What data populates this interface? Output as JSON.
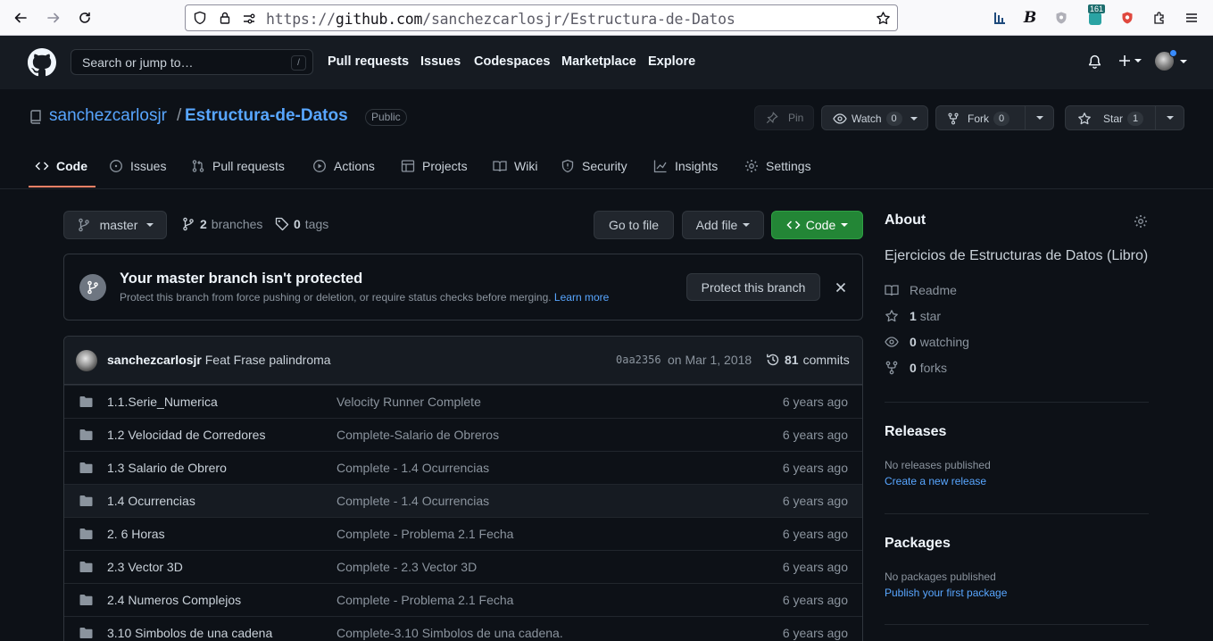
{
  "browser": {
    "url_scheme": "https://",
    "url_domain": "github.com",
    "url_path": "/sanchezcarlosjr/Estructura-de-Datos",
    "ext_badge": "161"
  },
  "header": {
    "search_placeholder": "Search or jump to…",
    "slash_key": "/",
    "nav": [
      "Pull requests",
      "Issues",
      "Codespaces",
      "Marketplace",
      "Explore"
    ]
  },
  "repo": {
    "owner": "sanchezcarlosjr",
    "separator": "/",
    "name": "Estructura-de-Datos",
    "visibility": "Public",
    "pin_label": "Pin",
    "watch_label": "Watch",
    "watch_count": "0",
    "fork_label": "Fork",
    "fork_count": "0",
    "star_label": "Star",
    "star_count": "1"
  },
  "tabs": [
    "Code",
    "Issues",
    "Pull requests",
    "Actions",
    "Projects",
    "Wiki",
    "Security",
    "Insights",
    "Settings"
  ],
  "toolbar": {
    "branch": "master",
    "branches_count": "2",
    "branches_label": "branches",
    "tags_count": "0",
    "tags_label": "tags",
    "go_to_file": "Go to file",
    "add_file": "Add file",
    "code": "Code"
  },
  "banner": {
    "title": "Your master branch isn't protected",
    "desc": "Protect this branch from force pushing or deletion, or require status checks before merging.",
    "link": "Learn more",
    "button": "Protect this branch"
  },
  "commit": {
    "author": "sanchezcarlosjr",
    "message": "Feat Frase palindroma",
    "sha": "0aa2356",
    "date": "on Mar 1, 2018",
    "count": "81",
    "count_label": "commits"
  },
  "files": [
    {
      "name": "1.1.Serie_Numerica",
      "message": "Velocity Runner Complete",
      "age": "6 years ago"
    },
    {
      "name": "1.2 Velocidad de Corredores",
      "message": "Complete-Salario de Obreros",
      "age": "6 years ago"
    },
    {
      "name": "1.3 Salario de Obrero",
      "message": "Complete - 1.4 Ocurrencias",
      "age": "6 years ago"
    },
    {
      "name": "1.4 Ocurrencias",
      "message": "Complete - 1.4 Ocurrencias",
      "age": "6 years ago"
    },
    {
      "name": "2. 6 Horas",
      "message": "Complete - Problema 2.1 Fecha",
      "age": "6 years ago"
    },
    {
      "name": "2.3 Vector 3D",
      "message": "Complete - 2.3 Vector 3D",
      "age": "6 years ago"
    },
    {
      "name": "2.4 Numeros Complejos",
      "message": "Complete - Problema 2.1 Fecha",
      "age": "6 years ago"
    },
    {
      "name": "3.10 Simbolos de una cadena",
      "message": "Complete-3.10 Simbolos de una cadena.",
      "age": "6 years ago"
    }
  ],
  "about": {
    "title": "About",
    "description": "Ejercicios de Estructuras de Datos (Libro)",
    "readme": "Readme",
    "stars_count": "1",
    "stars_label": "star",
    "watching_count": "0",
    "watching_label": "watching",
    "forks_count": "0",
    "forks_label": "forks"
  },
  "releases": {
    "title": "Releases",
    "none": "No releases published",
    "link": "Create a new release"
  },
  "packages": {
    "title": "Packages",
    "none": "No packages published",
    "link": "Publish your first package"
  },
  "colors": {
    "accent_link": "#58a6ff",
    "green_button": "#238636",
    "tab_underline": "#f78166",
    "background": "#0d1117"
  }
}
